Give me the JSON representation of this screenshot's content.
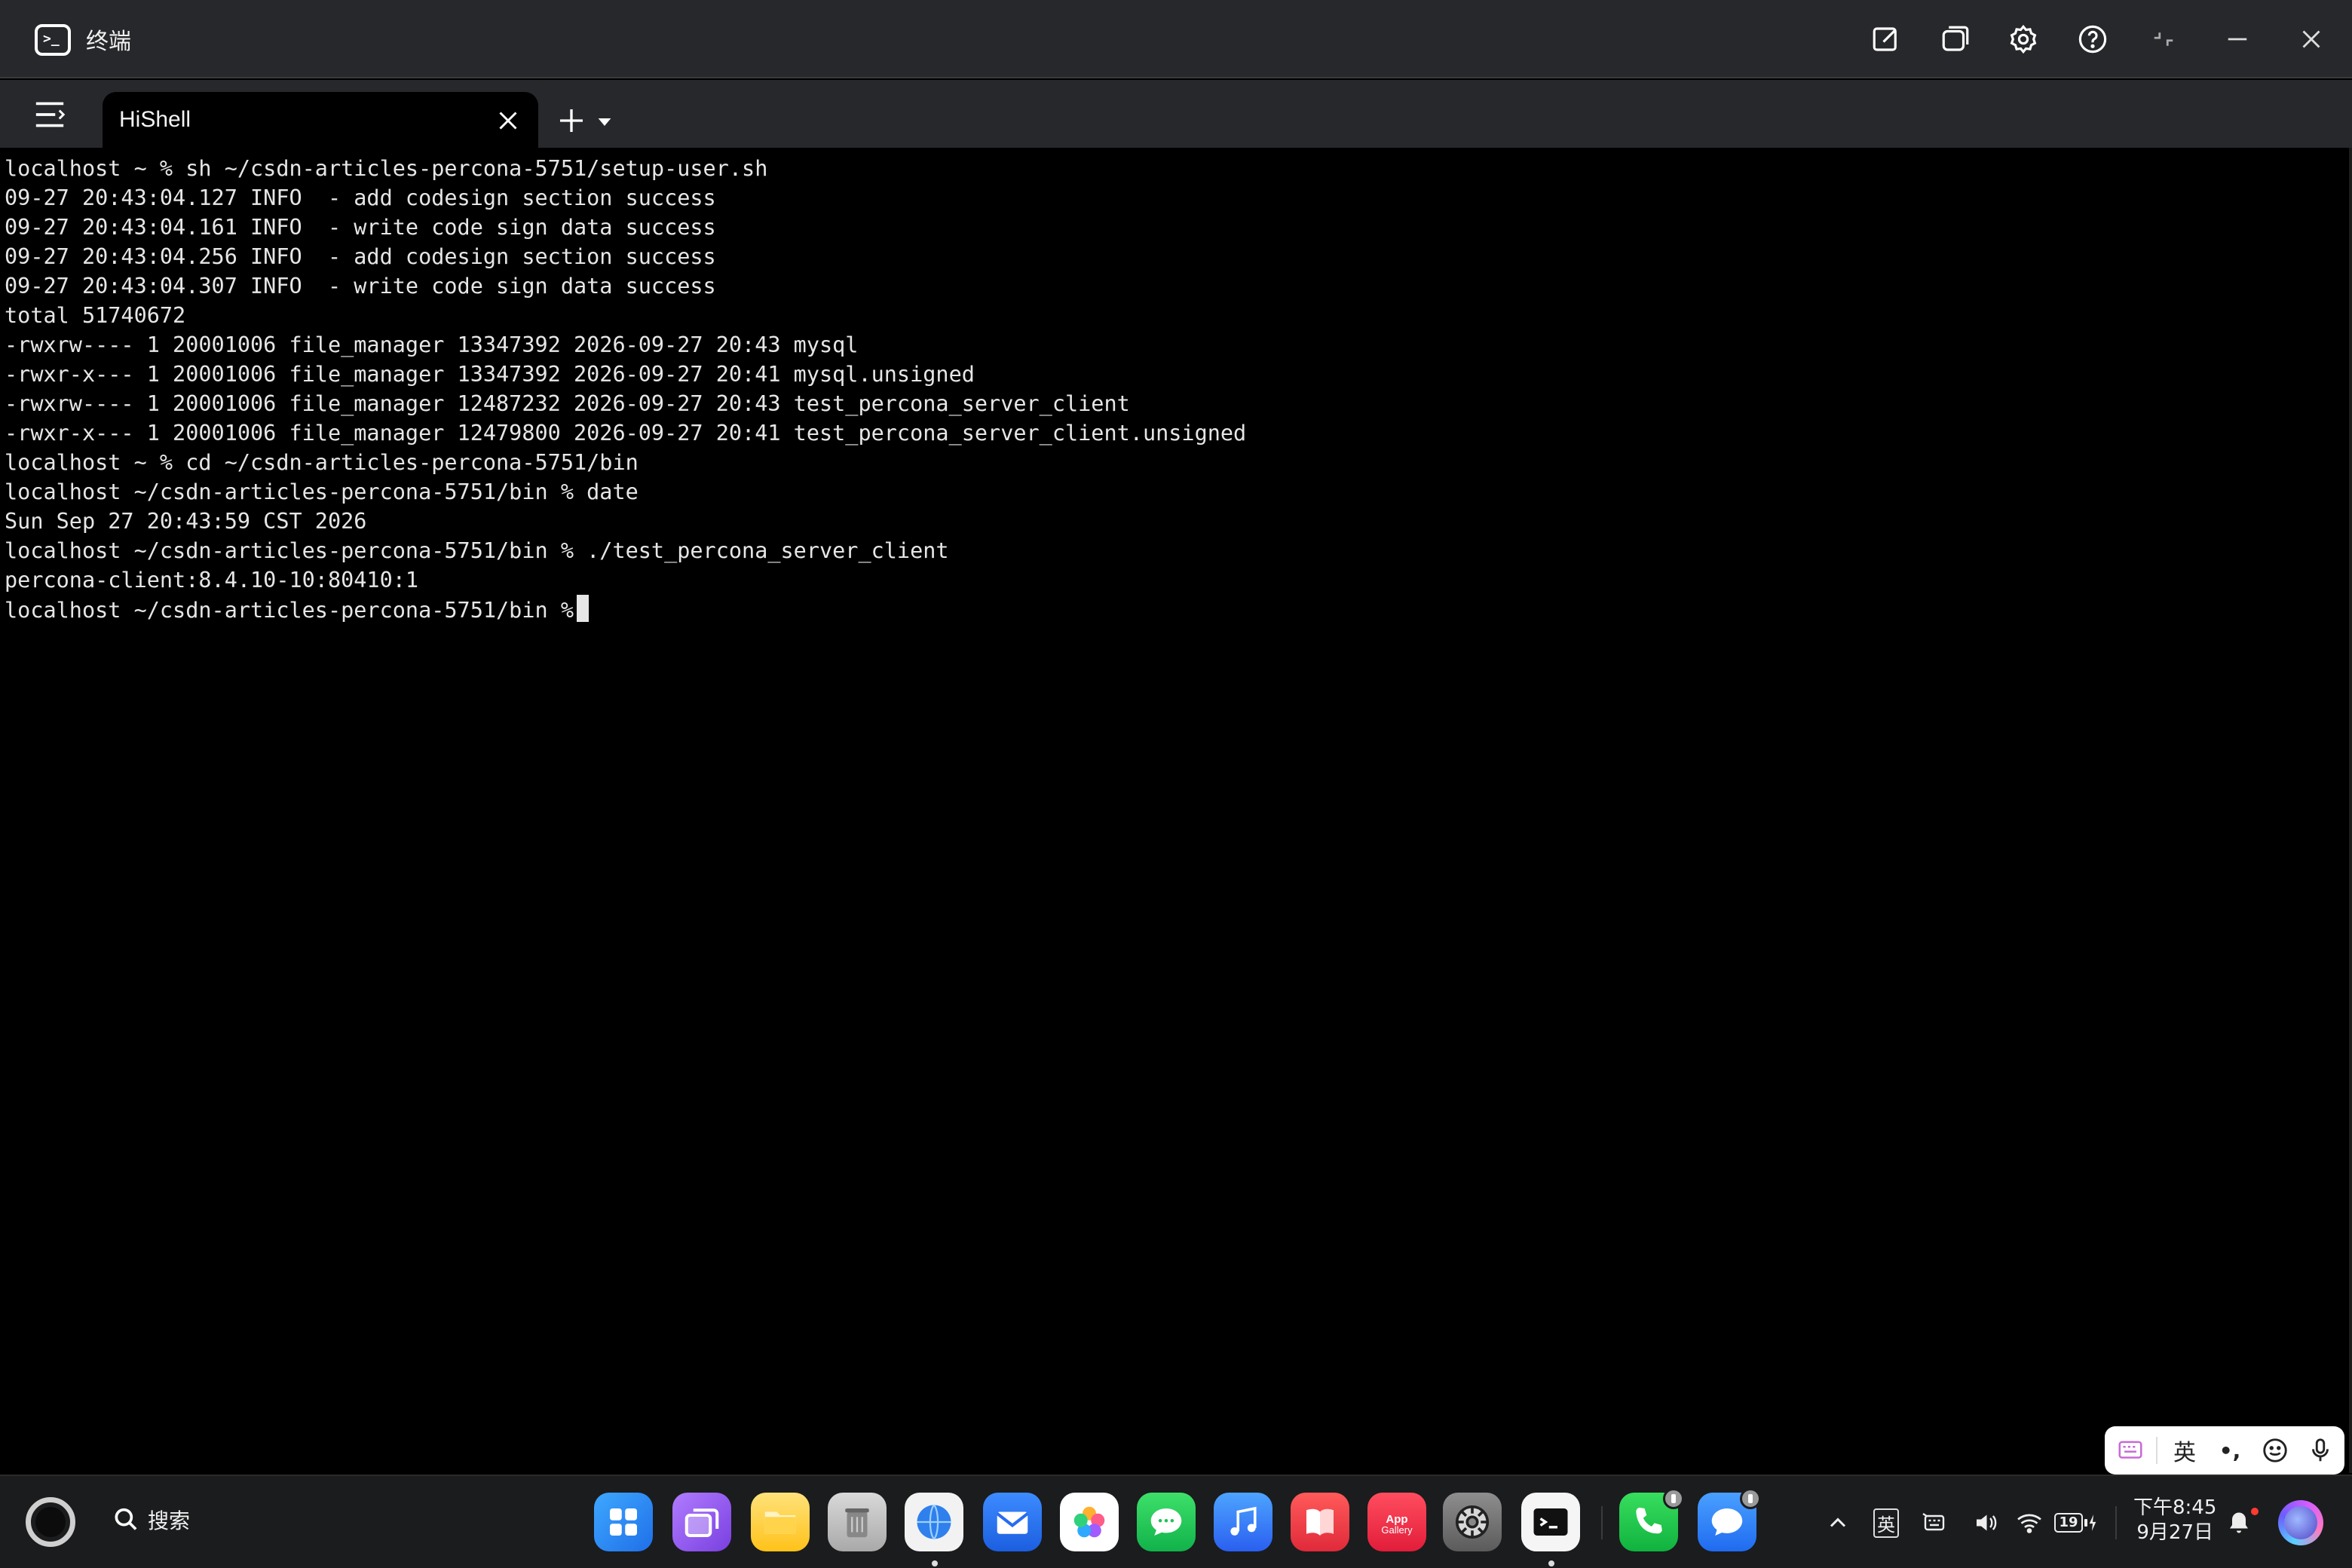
{
  "window": {
    "title": "终端"
  },
  "tabs": [
    {
      "label": "HiShell",
      "active": true
    }
  ],
  "terminal": {
    "lines": [
      "localhost ~ % sh ~/csdn-articles-percona-5751/setup-user.sh",
      "09-27 20:43:04.127 INFO  - add codesign section success",
      "09-27 20:43:04.161 INFO  - write code sign data success",
      "09-27 20:43:04.256 INFO  - add codesign section success",
      "09-27 20:43:04.307 INFO  - write code sign data success",
      "total 51740672",
      "-rwxrw---- 1 20001006 file_manager 13347392 2026-09-27 20:43 mysql",
      "-rwxr-x--- 1 20001006 file_manager 13347392 2026-09-27 20:41 mysql.unsigned",
      "-rwxrw---- 1 20001006 file_manager 12487232 2026-09-27 20:43 test_percona_server_client",
      "-rwxr-x--- 1 20001006 file_manager 12479800 2026-09-27 20:41 test_percona_server_client.unsigned",
      "localhost ~ % cd ~/csdn-articles-percona-5751/bin",
      "localhost ~/csdn-articles-percona-5751/bin % date",
      "Sun Sep 27 20:43:59 CST 2026",
      "localhost ~/csdn-articles-percona-5751/bin % ./test_percona_server_client",
      "percona-client:8.4.10-10:80410:1"
    ],
    "prompt": "localhost ~/csdn-articles-percona-5751/bin % "
  },
  "ime": {
    "lang": "英",
    "punct": "•,"
  },
  "taskbar": {
    "search_label": "搜索",
    "tray_lang": "英",
    "battery": "19",
    "clock_time": "下午8:45",
    "clock_date": "9月27日",
    "app_gallery_line1": "App",
    "app_gallery_line2": "Gallery"
  },
  "colors": {
    "titlebar": "#27282b",
    "terminal_bg": "#000000",
    "terminal_fg": "#e6e6e6",
    "taskbar": "#1b1c1e"
  },
  "icons": {
    "titlebar": [
      "edit-icon",
      "window-icon",
      "gear-icon",
      "help-icon",
      "restore-icon",
      "minimize-icon",
      "close-icon"
    ],
    "dock": [
      "launcher-grid",
      "multitask",
      "files",
      "trash",
      "browser",
      "mail",
      "photos",
      "messages",
      "music",
      "books",
      "app-gallery",
      "settings",
      "terminal",
      "phone",
      "chat"
    ]
  }
}
